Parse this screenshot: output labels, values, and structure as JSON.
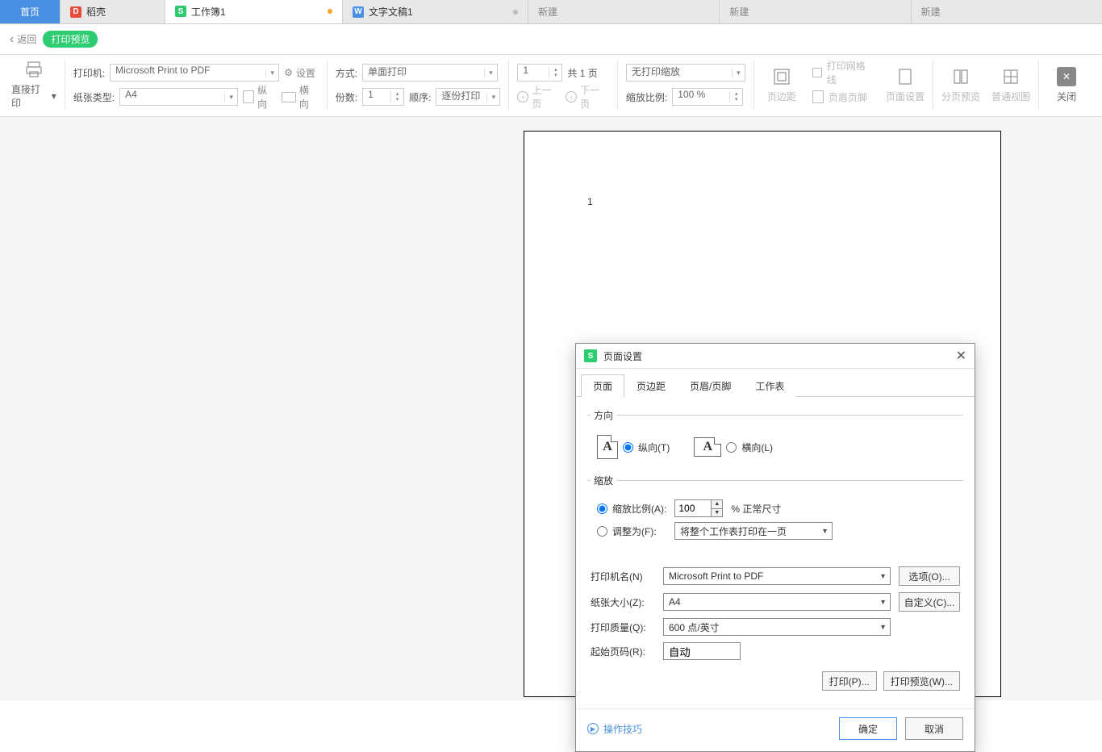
{
  "tabs": {
    "home": "首页",
    "daoke": "稻壳",
    "workbook": "工作簿1",
    "doc": "文字文稿1",
    "new": "新建"
  },
  "secondbar": {
    "back": "返回",
    "pill": "打印预览"
  },
  "toolbar": {
    "direct_print": "直接打印",
    "printer_label": "打印机:",
    "printer_value": "Microsoft Print to PDF",
    "settings": "设置",
    "paper_type_label": "纸张类型:",
    "paper_type_value": "A4",
    "portrait": "纵向",
    "landscape": "横向",
    "mode_label": "方式:",
    "mode_value": "单面打印",
    "copies_label": "份数:",
    "copies_value": "1",
    "order_label": "顺序:",
    "order_value": "逐份打印",
    "page_input": "1",
    "page_total": "共 1 页",
    "prev_page": "上一页",
    "next_page": "下一页",
    "scale_value": "无打印缩放",
    "scale_label": "缩放比例:",
    "scale_pct": "100 %",
    "margins": "页边距",
    "header_footer": "页眉页脚",
    "print_grid": "打印网格线",
    "page_setup": "页面设置",
    "paging_preview": "分页预览",
    "normal_view": "普通视图",
    "close": "关闭"
  },
  "paper": {
    "page_number": "1"
  },
  "dialog": {
    "title": "页面设置",
    "tabs": {
      "page": "页面",
      "margins": "页边距",
      "header": "页眉/页脚",
      "sheet": "工作表"
    },
    "orientation": {
      "legend": "方向",
      "portrait": "纵向(T)",
      "landscape": "横向(L)"
    },
    "scaling": {
      "legend": "缩放",
      "ratio_label": "缩放比例(A):",
      "ratio_value": "100",
      "ratio_suffix": "% 正常尺寸",
      "fit_label": "调整为(F):",
      "fit_value": "将整个工作表打印在一页"
    },
    "form": {
      "printer_label": "打印机名(N)",
      "printer_value": "Microsoft Print to PDF",
      "options_btn": "选项(O)...",
      "paper_label": "纸张大小(Z):",
      "paper_value": "A4",
      "custom_btn": "自定义(C)...",
      "quality_label": "打印质量(Q):",
      "quality_value": "600 点/英寸",
      "start_page_label": "起始页码(R):",
      "start_page_value": "自动"
    },
    "actions": {
      "print": "打印(P)...",
      "preview": "打印预览(W)..."
    },
    "tips": "操作技巧",
    "ok": "确定",
    "cancel": "取消"
  }
}
